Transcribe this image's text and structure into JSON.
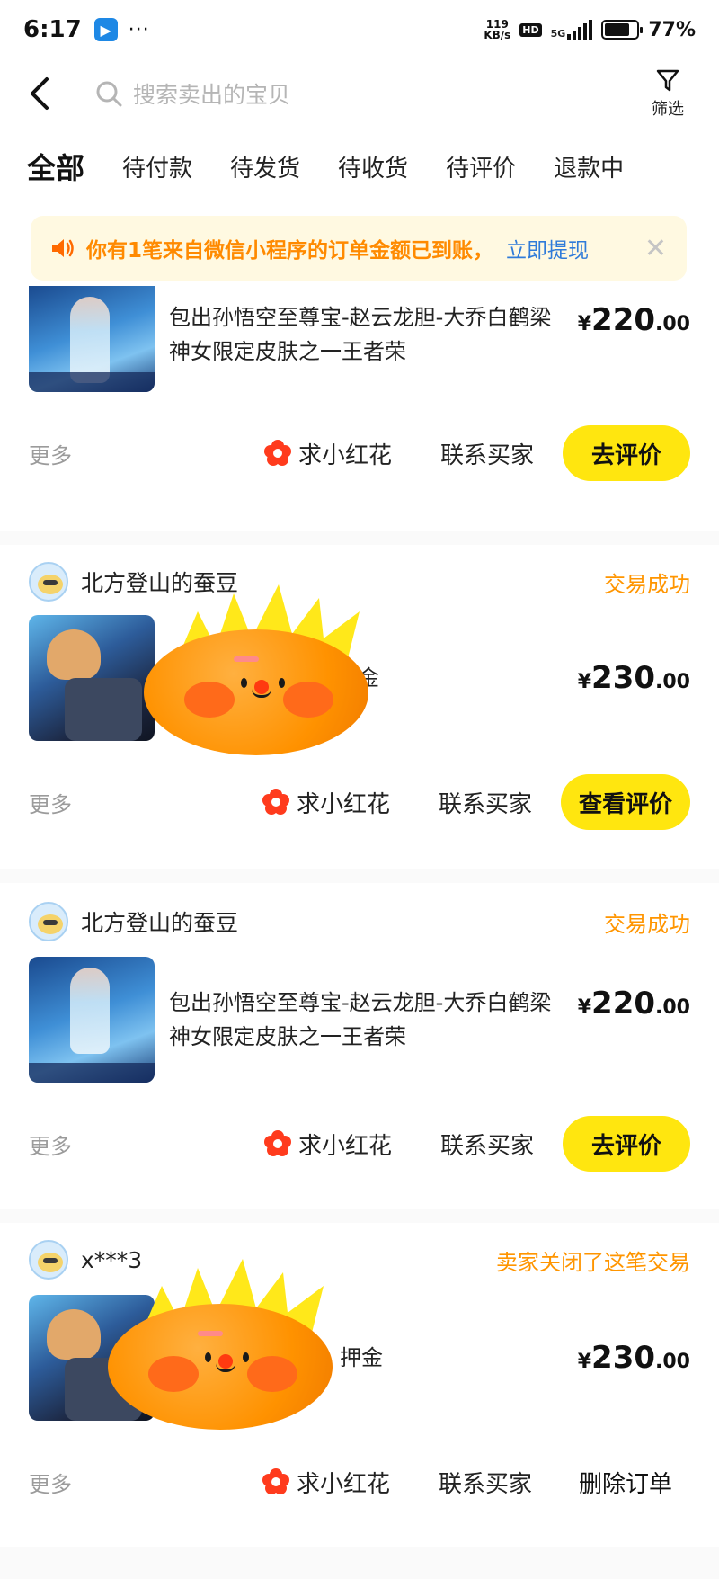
{
  "status_bar": {
    "time": "6:17",
    "app_badge": "▶",
    "dots": "···",
    "speed_top": "119",
    "speed_bottom": "KB/s",
    "hd": "HD",
    "network": "5G",
    "battery_pct": "77%",
    "battery_level": 0.77
  },
  "header": {
    "search_placeholder": "搜索卖出的宝贝",
    "filter_label": "筛选"
  },
  "tabs": [
    {
      "label": "全部",
      "active": true
    },
    {
      "label": "待付款"
    },
    {
      "label": "待发货"
    },
    {
      "label": "待收货"
    },
    {
      "label": "待评价"
    },
    {
      "label": "退款中"
    }
  ],
  "notice": {
    "text": "你有1笔来自微信小程序的订单金额已到账，",
    "link": "立即提现",
    "close": "✕"
  },
  "colors": {
    "accent_yellow": "#ffe60f",
    "status_orange": "#ff9500",
    "link_blue": "#2f7bd9"
  },
  "orders": [
    {
      "title": "包出孙悟空至尊宝-赵云龙胆-大乔白鹤梁神女限定皮肤之一王者荣",
      "price_cur": "¥",
      "price_int": "220",
      "price_dec": ".00",
      "more": "更多",
      "flower": "求小红花",
      "contact": "联系买家",
      "action": "去评价"
    },
    {
      "seller": "北方登山的蚕豆",
      "status": "交易成功",
      "title": "金",
      "price_cur": "¥",
      "price_int": "230",
      "price_dec": ".00",
      "more": "更多",
      "flower": "求小红花",
      "contact": "联系买家",
      "action": "查看评价"
    },
    {
      "seller": "北方登山的蚕豆",
      "status": "交易成功",
      "title": "包出孙悟空至尊宝-赵云龙胆-大乔白鹤梁神女限定皮肤之一王者荣",
      "price_cur": "¥",
      "price_int": "220",
      "price_dec": ".00",
      "more": "更多",
      "flower": "求小红花",
      "contact": "联系买家",
      "action": "去评价"
    },
    {
      "seller": "x***3",
      "status": "卖家关闭了这笔交易",
      "title": "押金",
      "price_cur": "¥",
      "price_int": "230",
      "price_dec": ".00",
      "more": "更多",
      "flower": "求小红花",
      "contact": "联系买家",
      "action": "删除订单"
    }
  ]
}
